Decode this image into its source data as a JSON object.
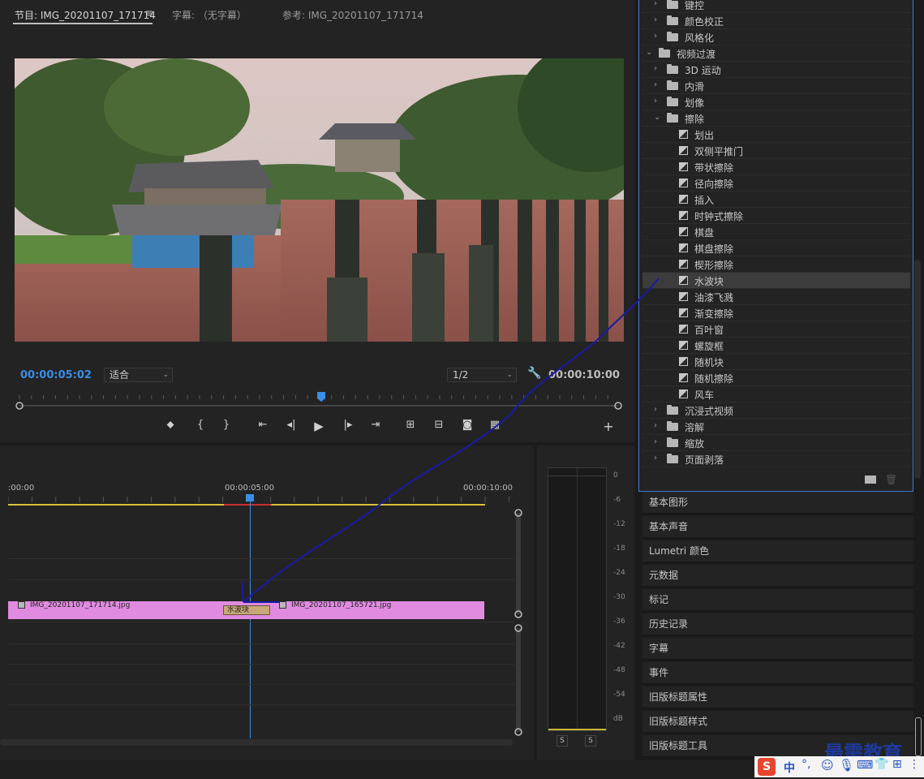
{
  "monitor": {
    "tabs": [
      {
        "label": "节目: IMG_20201107_171714"
      },
      {
        "label": "字幕: （无字幕）"
      },
      {
        "label": "参考: IMG_20201107_171714"
      }
    ],
    "menu_icon": "hamburger-icon",
    "current_time": "00:00:05:02",
    "fit_label": "适合",
    "resolution_label": "1/2",
    "duration": "00:00:10:00",
    "playhead_fraction": 0.5
  },
  "timeline": {
    "ruler": {
      "start": ":00:00",
      "mid": "00:00:05:00",
      "end": "00:00:10:00"
    },
    "clips": [
      {
        "name": "IMG_20201107_171714.jpg"
      },
      {
        "name": "IMG_20201107_165721.jpg"
      }
    ],
    "transition_label": "水波块"
  },
  "audio": {
    "db_ticks": [
      "0",
      "-6",
      "-12",
      "-18",
      "-24",
      "-30",
      "-36",
      "-42",
      "-48",
      "-54",
      "dB"
    ],
    "solo_labels": [
      "S",
      "S"
    ]
  },
  "effects": {
    "rows": [
      {
        "type": "folder",
        "expanded": false,
        "label": "键控",
        "level": 1
      },
      {
        "type": "folder",
        "expanded": false,
        "label": "颜色校正",
        "level": 1
      },
      {
        "type": "folder",
        "expanded": false,
        "label": "风格化",
        "level": 1
      },
      {
        "type": "folder",
        "expanded": true,
        "label": "视频过渡",
        "level": 0
      },
      {
        "type": "folder",
        "expanded": false,
        "label": "3D 运动",
        "level": 1
      },
      {
        "type": "folder",
        "expanded": false,
        "label": "内滑",
        "level": 1
      },
      {
        "type": "folder",
        "expanded": false,
        "label": "划像",
        "level": 1
      },
      {
        "type": "folder",
        "expanded": true,
        "label": "擦除",
        "level": 1
      },
      {
        "type": "item",
        "label": "划出"
      },
      {
        "type": "item",
        "label": "双侧平推门"
      },
      {
        "type": "item",
        "label": "带状擦除"
      },
      {
        "type": "item",
        "label": "径向擦除"
      },
      {
        "type": "item",
        "label": "插入"
      },
      {
        "type": "item",
        "label": "时钟式擦除"
      },
      {
        "type": "item",
        "label": "棋盘"
      },
      {
        "type": "item",
        "label": "棋盘擦除"
      },
      {
        "type": "item",
        "label": "楔形擦除"
      },
      {
        "type": "item",
        "label": "水波块",
        "selected": true
      },
      {
        "type": "item",
        "label": "油漆飞溅"
      },
      {
        "type": "item",
        "label": "渐变擦除"
      },
      {
        "type": "item",
        "label": "百叶窗"
      },
      {
        "type": "item",
        "label": "螺旋框"
      },
      {
        "type": "item",
        "label": "随机块"
      },
      {
        "type": "item",
        "label": "随机擦除"
      },
      {
        "type": "item",
        "label": "风车"
      },
      {
        "type": "folder",
        "expanded": false,
        "label": "沉浸式视频",
        "level": 1
      },
      {
        "type": "folder",
        "expanded": false,
        "label": "溶解",
        "level": 1
      },
      {
        "type": "folder",
        "expanded": false,
        "label": "缩放",
        "level": 1
      },
      {
        "type": "folder",
        "expanded": false,
        "label": "页面剥落",
        "level": 1
      }
    ]
  },
  "panels": [
    "基本图形",
    "基本声音",
    "Lumetri 颜色",
    "元数据",
    "标记",
    "历史记录",
    "字幕",
    "事件",
    "旧版标题属性",
    "旧版标题样式",
    "旧版标题工具"
  ],
  "watermark": "最需教育",
  "ime": {
    "label": "中"
  },
  "colors": {
    "accent_blue": "#3a8ee6",
    "clip_pink": "#e08be0",
    "transition_tan": "#c8a878",
    "annotation": "#1a1aa8"
  }
}
